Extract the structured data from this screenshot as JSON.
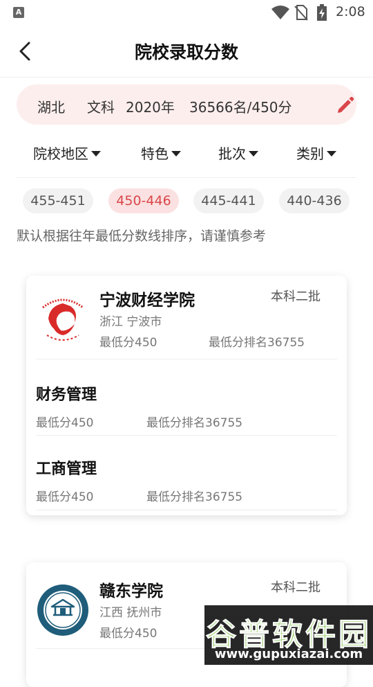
{
  "status_bar": {
    "time": "2:08",
    "app_badge": "A"
  },
  "header": {
    "title": "院校录取分数"
  },
  "profile": {
    "province": "湖北",
    "subject": "文科",
    "year": "2020年",
    "rank_score": "36566名/450分"
  },
  "filters": [
    {
      "label": "院校地区"
    },
    {
      "label": "特色"
    },
    {
      "label": "批次"
    },
    {
      "label": "类别"
    }
  ],
  "score_ranges": [
    {
      "label": "455-451",
      "active": false
    },
    {
      "label": "450-446",
      "active": true
    },
    {
      "label": "445-441",
      "active": false
    },
    {
      "label": "440-436",
      "active": false
    }
  ],
  "note": "默认根据往年最低分数线排序，请谨慎参考",
  "colors": {
    "accent": "#d9464b",
    "pill_bg": "#fdeeee",
    "chip_active_bg": "#fbe1e1"
  },
  "universities": [
    {
      "name": "宁波财经学院",
      "batch": "本科二批",
      "region": "浙江 宁波市",
      "min_score": "最低分450",
      "min_rank": "最低分排名36755",
      "logo": "phoenix-logo",
      "majors": [
        {
          "name": "财务管理",
          "min_score": "最低分450",
          "min_rank": "最低分排名36755"
        },
        {
          "name": "工商管理",
          "min_score": "最低分450",
          "min_rank": "最低分排名36755"
        }
      ]
    },
    {
      "name": "赣东学院",
      "batch": "本科二批",
      "region": "江西 抚州市",
      "min_score": "最低分450",
      "logo": "college-seal-logo"
    }
  ],
  "watermark": {
    "title": "谷普软件园",
    "url": "www.gupuxiazai.com"
  }
}
